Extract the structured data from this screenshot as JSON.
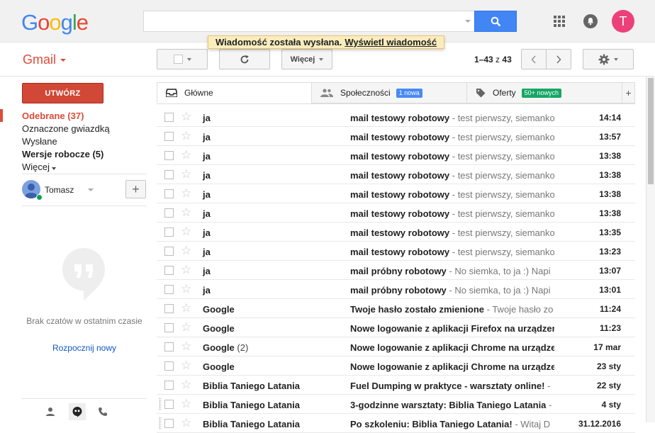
{
  "header": {
    "logo": [
      "G",
      "o",
      "o",
      "g",
      "l",
      "e"
    ],
    "search_value": "",
    "avatar_letter": "T"
  },
  "notice": {
    "text": "Wiadomość została wysłana.",
    "link": "Wyświetl wiadomość"
  },
  "toolbar": {
    "app_label": "Gmail",
    "more_label": "Więcej",
    "range": "1–43",
    "of": "z",
    "total": "43"
  },
  "sidebar": {
    "compose_label": "UTWÓRZ",
    "items": [
      {
        "label": "Odebrane (37)"
      },
      {
        "label": "Oznaczone gwiazdką"
      },
      {
        "label": "Wysłane"
      },
      {
        "label": "Wersje robocze (5)"
      },
      {
        "label": "Więcej"
      }
    ],
    "user_name": "Tomasz",
    "chat_empty": "Brak czatów w ostatnim czasie",
    "chat_start": "Rozpocznij nowy"
  },
  "tabs": [
    {
      "label": "Główne",
      "badge": ""
    },
    {
      "label": "Społeczności",
      "badge": "1 nowa",
      "badge_color": "#4a8af4"
    },
    {
      "label": "Oferty",
      "badge": "50+ nowych",
      "badge_color": "#16a765"
    }
  ],
  "emails": [
    {
      "sender": "ja",
      "count": "",
      "subject": "mail testowy robotowy",
      "snippet": " - test pierwszy, siemanko",
      "date": "14:14"
    },
    {
      "sender": "ja",
      "count": "",
      "subject": "mail testowy robotowy",
      "snippet": " - test pierwszy, siemanko",
      "date": "13:57"
    },
    {
      "sender": "ja",
      "count": "",
      "subject": "mail testowy robotowy",
      "snippet": " - test pierwszy, siemanko",
      "date": "13:38"
    },
    {
      "sender": "ja",
      "count": "",
      "subject": "mail testowy robotowy",
      "snippet": " - test pierwszy, siemanko",
      "date": "13:38"
    },
    {
      "sender": "ja",
      "count": "",
      "subject": "mail testowy robotowy",
      "snippet": " - test pierwszy, siemanko",
      "date": "13:38"
    },
    {
      "sender": "ja",
      "count": "",
      "subject": "mail testowy robotowy",
      "snippet": " - test pierwszy, siemanko",
      "date": "13:38"
    },
    {
      "sender": "ja",
      "count": "",
      "subject": "mail testowy robotowy",
      "snippet": " - test pierwszy, siemanko",
      "date": "13:35"
    },
    {
      "sender": "ja",
      "count": "",
      "subject": "mail testowy robotowy",
      "snippet": " - test pierwszy, siemanko",
      "date": "13:23"
    },
    {
      "sender": "ja",
      "count": "",
      "subject": "mail próbny robotowy",
      "snippet": " - No siemka, to ja :) Napi",
      "date": "13:07"
    },
    {
      "sender": "ja",
      "count": "",
      "subject": "mail próbny robotowy",
      "snippet": " - No siemka, to ja :) Napi",
      "date": "13:01"
    },
    {
      "sender": "Google",
      "count": "",
      "subject": "Twoje hasło zostało zmienione",
      "snippet": " - Twoje hasło zo",
      "date": "11:24"
    },
    {
      "sender": "Google",
      "count": "",
      "subject": "Nowe logowanie z aplikacji Firefox na urządzeniu",
      "snippet": "",
      "date": "11:23"
    },
    {
      "sender": "Google",
      "count": "(2)",
      "subject": "Nowe logowanie z aplikacji Chrome na urządzeniu",
      "snippet": "",
      "date": "17 mar"
    },
    {
      "sender": "Google",
      "count": "",
      "subject": "Nowe logowanie z aplikacji Chrome na urządzeniu",
      "snippet": "",
      "date": "23 sty"
    },
    {
      "sender": "Biblia Taniego Latania",
      "count": "",
      "subject": "Fuel Dumping w praktyce - warsztaty online!",
      "snippet": " - ",
      "date": "22 sty"
    },
    {
      "sender": "Biblia Taniego Latania",
      "count": "",
      "subject": "3-godzinne warsztaty: Biblia Taniego Latania",
      "snippet": " - ",
      "date": "4 sty"
    },
    {
      "sender": "Biblia Taniego Latania",
      "count": "",
      "subject": "Po szkoleniu: Biblia Taniego Latania!",
      "snippet": " - Witaj D",
      "date": "31.12.2016"
    }
  ]
}
